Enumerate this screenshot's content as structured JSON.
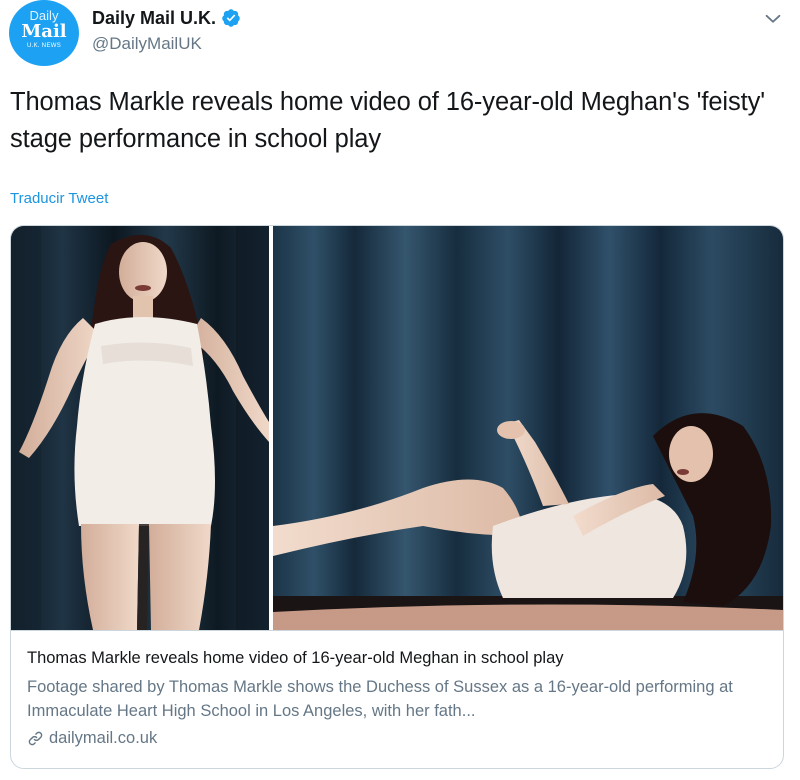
{
  "account": {
    "avatar": {
      "line1": "Daily",
      "line2": "Mail",
      "line3": "U.K. NEWS"
    },
    "name": "Daily Mail U.K.",
    "handle": "@DailyMailUK",
    "verified": true
  },
  "tweet": {
    "text": "Thomas Markle reveals home video of 16-year-old Meghan's 'feisty' stage performance in school play",
    "translate_label": "Traducir Tweet"
  },
  "card": {
    "title": "Thomas Markle reveals home video of 16-year-old Meghan in school play",
    "description": "Footage shared by Thomas Markle shows the Duchess of Sussex as a 16-year-old performing at Immaculate Heart High School in Los Angeles, with her fath...",
    "domain": "dailymail.co.uk"
  },
  "icons": {
    "verified": "verified-badge-icon",
    "caret": "chevron-down-icon",
    "link": "link-icon"
  },
  "colors": {
    "accent": "#1da1f2",
    "link": "#1b95e0",
    "secondary_text": "#657786",
    "border": "#ccd6dd"
  }
}
